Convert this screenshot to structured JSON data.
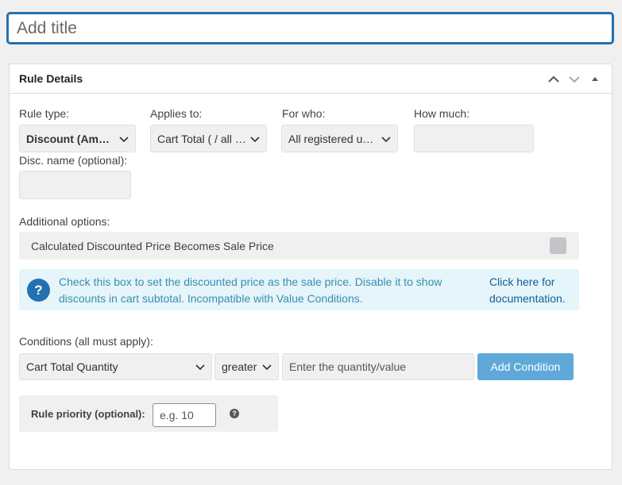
{
  "title_field": {
    "placeholder": "Add title"
  },
  "metabox": {
    "title": "Rule Details",
    "actions": {
      "move_up": "chevron-up",
      "move_down": "chevron-down",
      "toggle": "triangle-up"
    }
  },
  "rule": {
    "rule_type": {
      "label": "Rule type:",
      "value": "Discount (Amount)"
    },
    "applies_to": {
      "label": "Applies to:",
      "value": "Cart Total ( / all products)"
    },
    "for_who": {
      "label": "For who:",
      "value": "All registered users"
    },
    "how_much": {
      "label": "How much:",
      "value": ""
    },
    "disc_name": {
      "label": "Disc. name (optional):",
      "value": ""
    }
  },
  "additional": {
    "label": "Additional options:",
    "option_label": "Calculated Discounted Price Becomes Sale Price",
    "checked": false
  },
  "info": {
    "icon": "?",
    "text": "Check this box to set the discounted price as the sale price. Disable it to show discounts in cart subtotal. Incompatible with Value Conditions.",
    "link": "Click here for documentation."
  },
  "conditions": {
    "label": "Conditions (all must apply):",
    "field": "Cart Total Quantity",
    "operator": "greater (",
    "value_placeholder": "Enter the quantity/value",
    "add_button": "Add Condition"
  },
  "priority": {
    "label": "Rule priority (optional):",
    "placeholder": "e.g. 10",
    "help_icon": "?"
  },
  "colors": {
    "accent": "#2271b1",
    "button": "#5ea9d8",
    "info_bg": "#e5f5fa",
    "info_text": "#3b8db1"
  }
}
